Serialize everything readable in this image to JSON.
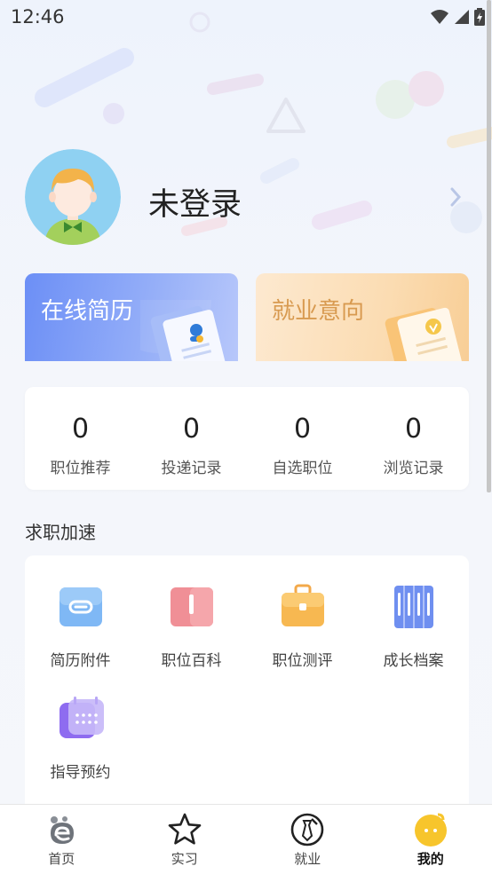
{
  "status_bar": {
    "time": "12:46"
  },
  "profile": {
    "login_status": "未登录"
  },
  "cards": {
    "resume": {
      "title": "在线简历"
    },
    "intent": {
      "title": "就业意向"
    }
  },
  "stats": [
    {
      "value": "0",
      "label": "职位推荐"
    },
    {
      "value": "0",
      "label": "投递记录"
    },
    {
      "value": "0",
      "label": "自选职位"
    },
    {
      "value": "0",
      "label": "浏览记录"
    }
  ],
  "section": {
    "title": "求职加速"
  },
  "services": [
    {
      "label": "简历附件",
      "icon": "paperclip-icon"
    },
    {
      "label": "职位百科",
      "icon": "book-icon"
    },
    {
      "label": "职位测评",
      "icon": "briefcase-icon"
    },
    {
      "label": "成长档案",
      "icon": "archive-icon"
    },
    {
      "label": "指导预约",
      "icon": "calendar-icon"
    }
  ],
  "nav": [
    {
      "label": "首页",
      "icon": "home-icon"
    },
    {
      "label": "实习",
      "icon": "star-icon"
    },
    {
      "label": "就业",
      "icon": "tie-icon"
    },
    {
      "label": "我的",
      "icon": "profile-face-icon",
      "active": true
    }
  ],
  "colors": {
    "resume_card": "#7b9bf7",
    "intent_card": "#fbdcb2",
    "intent_text": "#d89a50",
    "active_nav": "#f7c52c"
  }
}
